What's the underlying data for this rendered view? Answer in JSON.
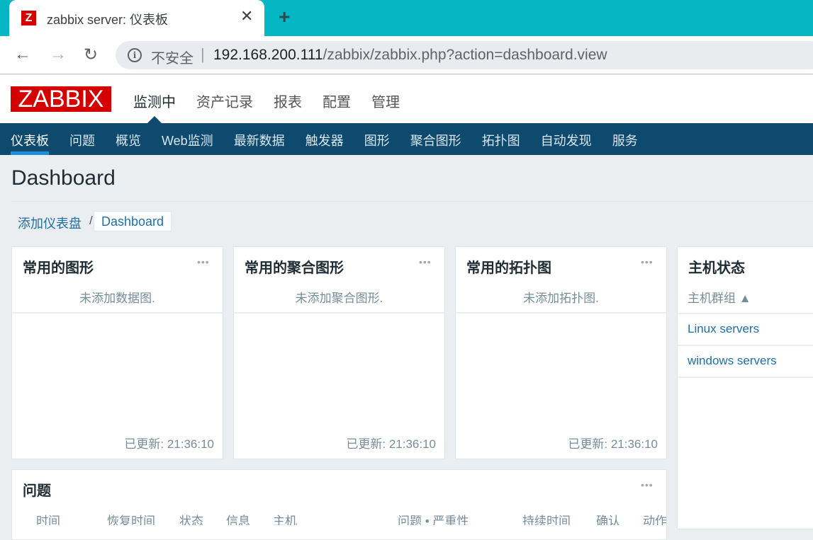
{
  "browser": {
    "tab_title": "zabbix server: 仪表板",
    "favicon_letter": "Z",
    "close_glyph": "✕",
    "newtab_glyph": "+",
    "back_glyph": "←",
    "forward_glyph": "→",
    "reload_glyph": "↻",
    "security_label": "不安全",
    "url_host": "192.168.200.111",
    "url_path": "/zabbix/zabbix.php?action=dashboard.view",
    "colors": {
      "tabbar": "#05b7c3"
    }
  },
  "app": {
    "logo": "ZABBIX",
    "brand_color": "#d40000",
    "top_menu": [
      {
        "label": "监测中",
        "active": true
      },
      {
        "label": "资产记录"
      },
      {
        "label": "报表"
      },
      {
        "label": "配置"
      },
      {
        "label": "管理"
      }
    ],
    "sub_menu": [
      {
        "label": "仪表板",
        "active": true
      },
      {
        "label": "问题"
      },
      {
        "label": "概览"
      },
      {
        "label": "Web监测"
      },
      {
        "label": "最新数据"
      },
      {
        "label": "触发器"
      },
      {
        "label": "图形"
      },
      {
        "label": "聚合图形"
      },
      {
        "label": "拓扑图"
      },
      {
        "label": "自动发现"
      },
      {
        "label": "服务"
      }
    ]
  },
  "page": {
    "title": "Dashboard",
    "breadcrumb": {
      "parent": "添加仪表盘",
      "separator": "/",
      "current": "Dashboard"
    }
  },
  "widgets": {
    "fav_graphs": {
      "title": "常用的图形",
      "empty": "未添加数据图.",
      "updated": "已更新: 21:36:10",
      "menu": "•••"
    },
    "fav_screens": {
      "title": "常用的聚合图形",
      "empty": "未添加聚合图形.",
      "updated": "已更新: 21:36:10",
      "menu": "•••"
    },
    "fav_maps": {
      "title": "常用的拓扑图",
      "empty": "未添加拓扑图.",
      "updated": "已更新: 21:36:10",
      "menu": "•••"
    },
    "host_status": {
      "title": "主机状态",
      "column": "主机群组 ▲",
      "rows": [
        "Linux servers",
        "windows servers"
      ]
    },
    "problems": {
      "title": "问题",
      "menu": "•••",
      "columns": [
        "时间",
        "恢复时间",
        "状态",
        "信息",
        "主机",
        "问题 • 严重性",
        "持续时间",
        "确认",
        "动作"
      ]
    }
  }
}
